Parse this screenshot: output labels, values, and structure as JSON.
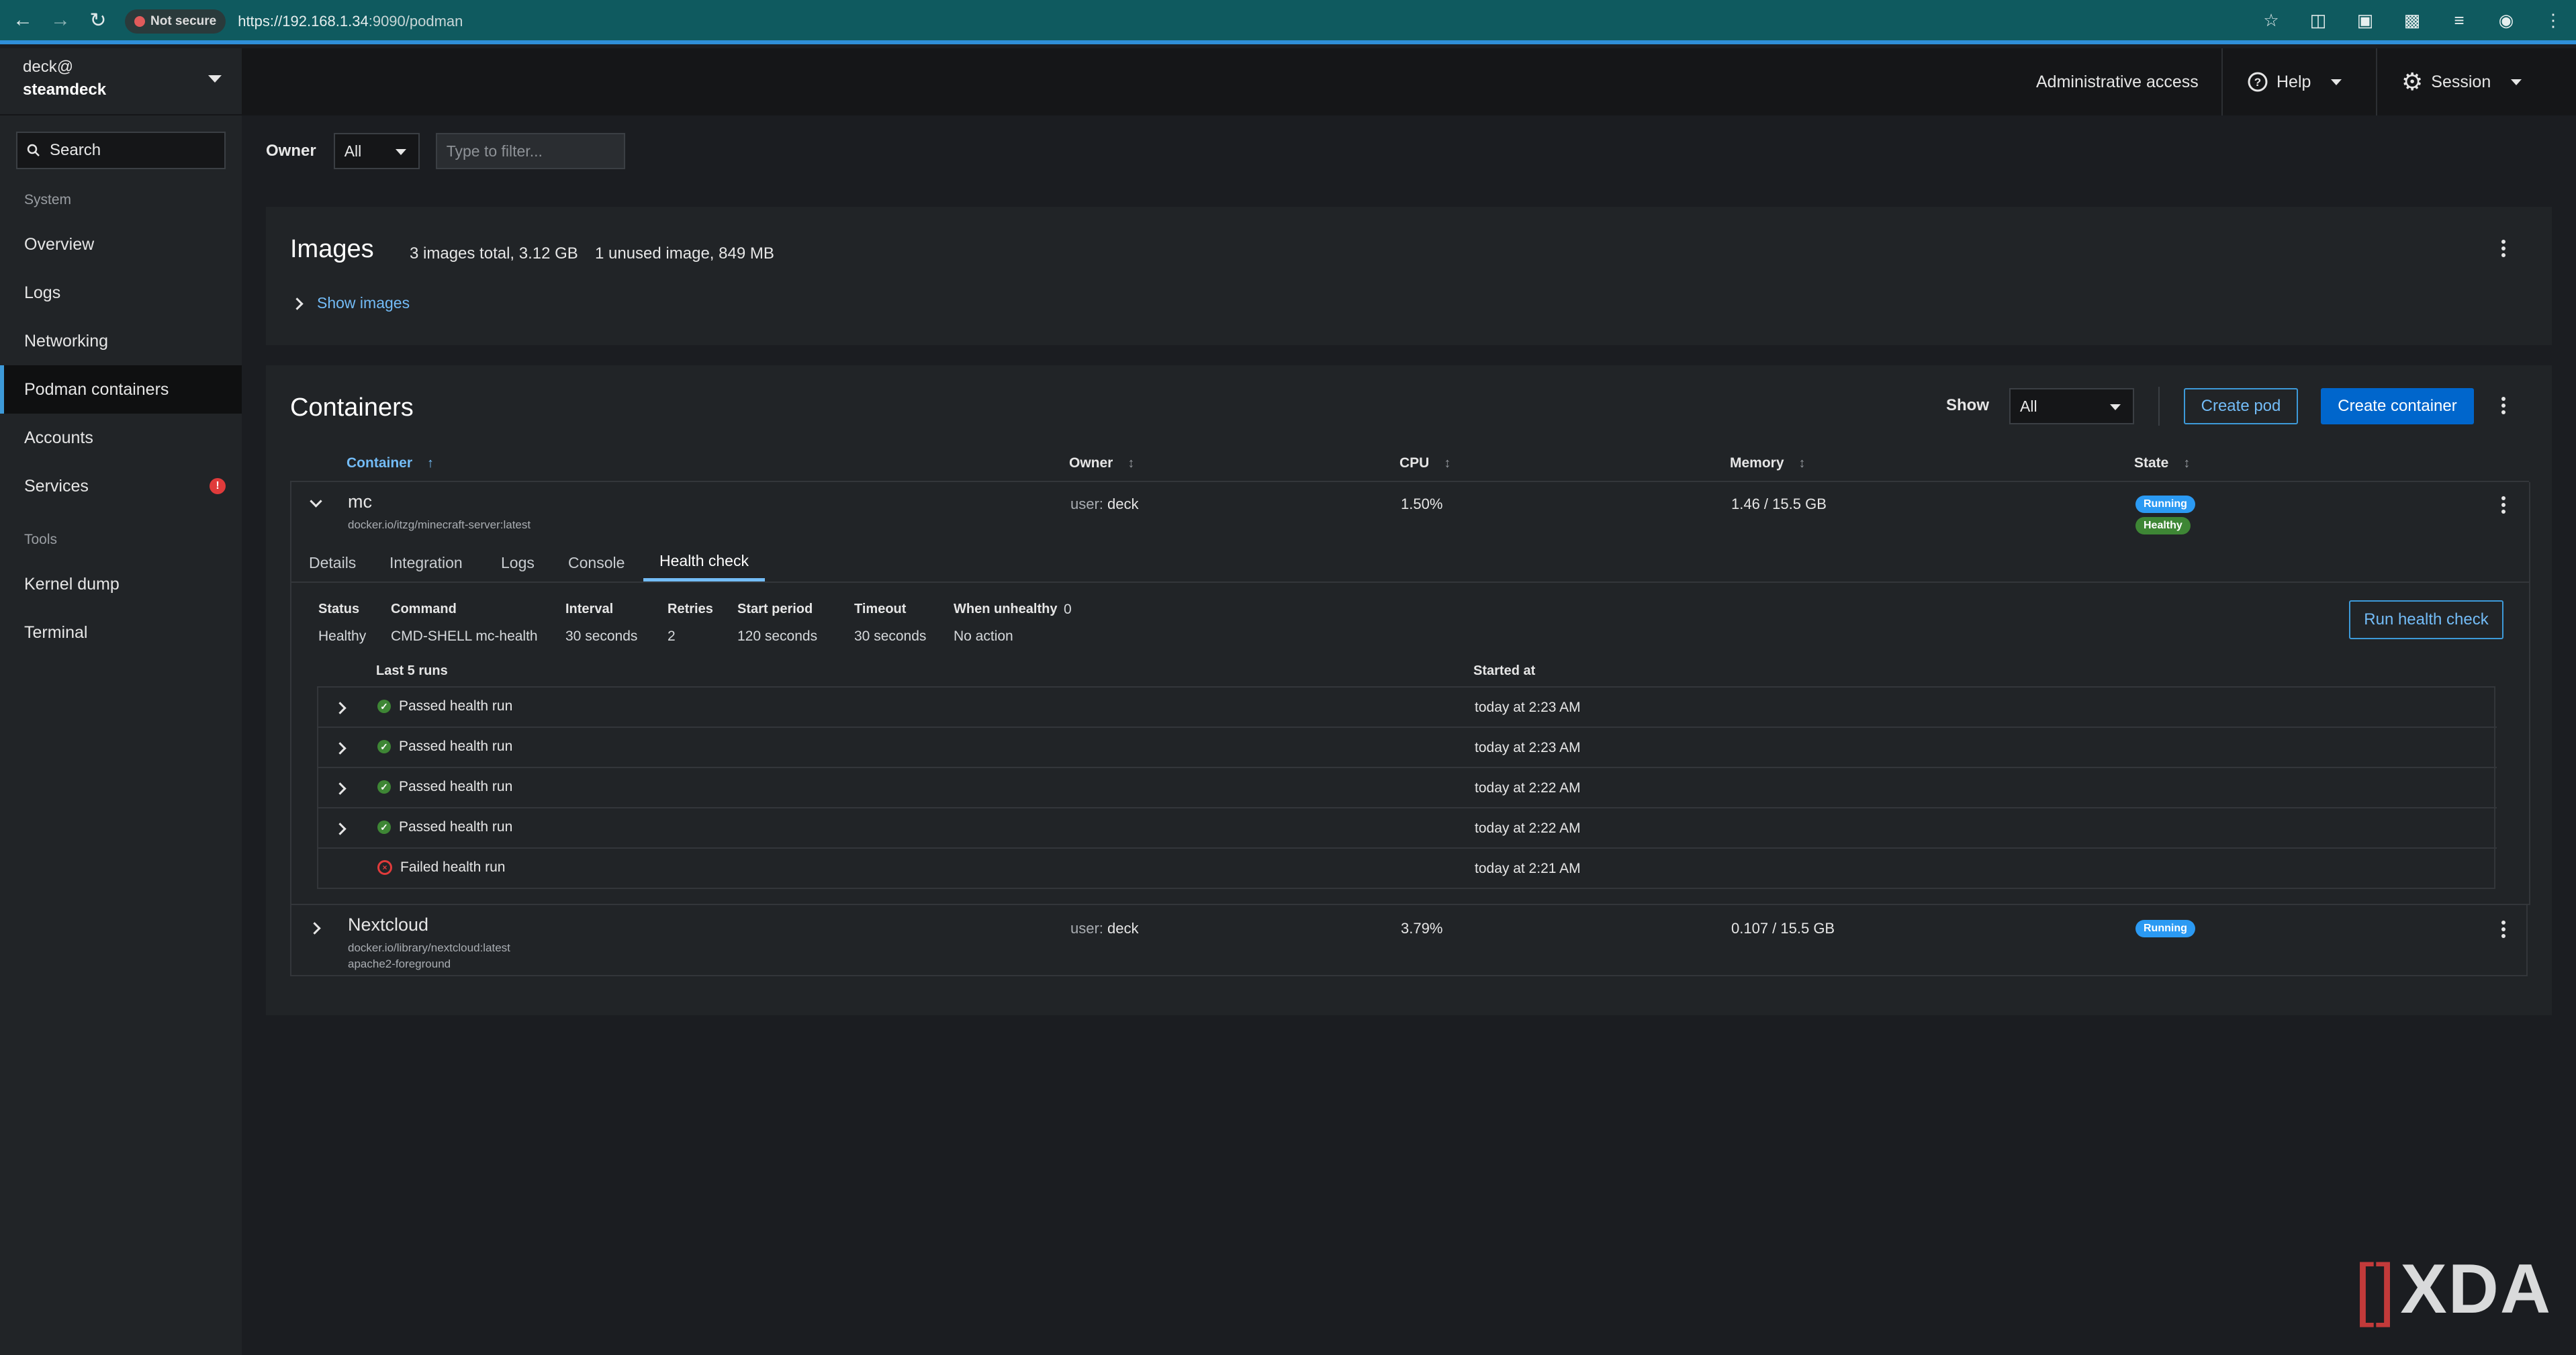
{
  "browser": {
    "not_secure": "Not secure",
    "url_scheme": "https://",
    "url_host": "192.168.1.34",
    "url_rest": ":9090/podman"
  },
  "sidebar": {
    "user_line": "deck@",
    "host_line": "steamdeck",
    "search_label": "Search",
    "group_system": "System",
    "items_system": [
      {
        "label": "Overview"
      },
      {
        "label": "Logs"
      },
      {
        "label": "Networking"
      },
      {
        "label": "Podman containers"
      },
      {
        "label": "Accounts"
      },
      {
        "label": "Services",
        "badge": "!"
      }
    ],
    "group_tools": "Tools",
    "items_tools": [
      {
        "label": "Kernel dump"
      },
      {
        "label": "Terminal"
      }
    ]
  },
  "masthead": {
    "admin": "Administrative access",
    "help": "Help",
    "session": "Session"
  },
  "toolbar": {
    "owner_label": "Owner",
    "owner_value": "All",
    "filter_placeholder": "Type to filter..."
  },
  "images": {
    "title": "Images",
    "total": "3 images total, 3.12 GB",
    "unused": "1 unused image, 849 MB",
    "show_link": "Show images"
  },
  "containers": {
    "title": "Containers",
    "show_label": "Show",
    "show_value": "All",
    "create_pod": "Create pod",
    "create_container": "Create container",
    "columns": {
      "container": "Container",
      "owner": "Owner",
      "cpu": "CPU",
      "memory": "Memory",
      "state": "State"
    },
    "rows": [
      {
        "name": "mc",
        "image": "docker.io/itzg/minecraft-server:latest",
        "owner_prefix": "user:",
        "owner": "deck",
        "cpu": "1.50%",
        "memory": "1.46 / 15.5 GB",
        "state": "Running",
        "health": "Healthy"
      },
      {
        "name": "Nextcloud",
        "image": "docker.io/library/nextcloud:latest",
        "command": "apache2-foreground",
        "owner_prefix": "user:",
        "owner": "deck",
        "cpu": "3.79%",
        "memory": "0.107 / 15.5 GB",
        "state": "Running"
      }
    ],
    "tabs": [
      "Details",
      "Integration",
      "Logs",
      "Console",
      "Health check"
    ],
    "health_check": {
      "labels": {
        "status": "Status",
        "command": "Command",
        "interval": "Interval",
        "retries": "Retries",
        "start_period": "Start period",
        "timeout": "Timeout",
        "when_unhealthy": "When unhealthy"
      },
      "values": {
        "status": "Healthy",
        "command": "CMD-SHELL mc-health",
        "interval": "30 seconds",
        "retries": "2",
        "start_period": "120 seconds",
        "timeout": "30 seconds",
        "when_unhealthy": "No action",
        "failing_streak": "0"
      },
      "run_button": "Run health check",
      "runs_header": "Last 5 runs",
      "started_header": "Started at",
      "runs": [
        {
          "status": "Passed health run",
          "started": "today at 2:23 AM",
          "result": "pass"
        },
        {
          "status": "Passed health run",
          "started": "today at 2:23 AM",
          "result": "pass"
        },
        {
          "status": "Passed health run",
          "started": "today at 2:22 AM",
          "result": "pass"
        },
        {
          "status": "Passed health run",
          "started": "today at 2:22 AM",
          "result": "pass"
        },
        {
          "status": "Failed health run",
          "started": "today at 2:21 AM",
          "result": "fail"
        }
      ]
    }
  },
  "watermark": {
    "text": "XDA"
  },
  "colors": {
    "accent": "#73bcf7",
    "primary_button": "#0066cc",
    "running": "#2b9af3",
    "healthy": "#3e8635",
    "failed": "#e03b3b"
  }
}
